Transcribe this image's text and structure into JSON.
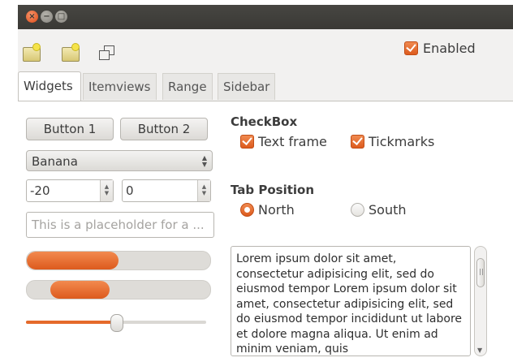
{
  "toolbar": {
    "enabled_label": "Enabled"
  },
  "tabs": [
    {
      "label": "Widgets"
    },
    {
      "label": "Itemviews"
    },
    {
      "label": "Range"
    },
    {
      "label": "Sidebar"
    }
  ],
  "widgets": {
    "button1_label": "Button 1",
    "button2_label": "Button 2",
    "combo_value": "Banana",
    "spin1_value": "-20",
    "spin2_value": "0",
    "entry_placeholder": "This is a placeholder for a ...",
    "progress1": 0.5,
    "progress2_start": 0.13,
    "progress2_end": 0.45,
    "slider_value": 0.5
  },
  "checkbox_section": {
    "title": "CheckBox",
    "text_frame_label": "Text frame",
    "tickmarks_label": "Tickmarks"
  },
  "tab_position": {
    "title": "Tab Position",
    "north_label": "North",
    "south_label": "South",
    "selected": "North"
  },
  "textview": {
    "text": "Lorem ipsum dolor sit amet, consectetur adipisicing elit, sed do eiusmod tempor Lorem ipsum dolor sit amet, consectetur adipisicing elit, sed do eiusmod tempor incididunt ut labore et dolore magna aliqua. Ut enim ad minim veniam, quis"
  },
  "colors": {
    "accent": "#dd5b1e",
    "titlebar": "#3a3935",
    "window_bg": "#f2f1f0"
  }
}
